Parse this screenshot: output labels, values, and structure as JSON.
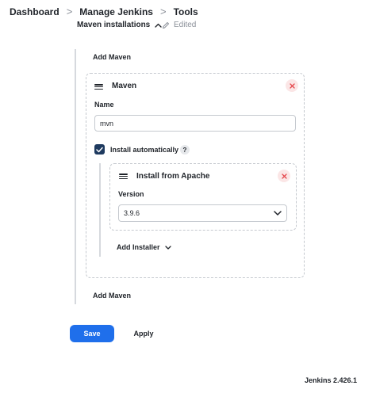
{
  "breadcrumb": {
    "items": [
      "Dashboard",
      "Manage Jenkins",
      "Tools"
    ],
    "separator": ">"
  },
  "section": {
    "title": "Maven installations",
    "status": "Edited"
  },
  "add_maven_label": "Add Maven",
  "maven_card": {
    "title": "Maven",
    "name_label": "Name",
    "name_value": "mvn",
    "install_auto_label": "Install automatically",
    "install_auto_checked": true,
    "help_label": "?"
  },
  "installer_card": {
    "title": "Install from Apache",
    "version_label": "Version",
    "version_value": "3.9.6"
  },
  "add_installer_label": "Add Installer",
  "buttons": {
    "save": "Save",
    "apply": "Apply"
  },
  "footer": {
    "version": "Jenkins 2.426.1"
  },
  "colors": {
    "primary": "#1f6feb",
    "checkbox": "#1e3a5f",
    "danger": "#e5484d",
    "danger_bg": "#fbe6e6"
  },
  "icons": [
    "chevron-up-icon",
    "pencil-icon",
    "drag-handle-icon",
    "close-icon",
    "check-icon",
    "chevron-down-icon"
  ]
}
